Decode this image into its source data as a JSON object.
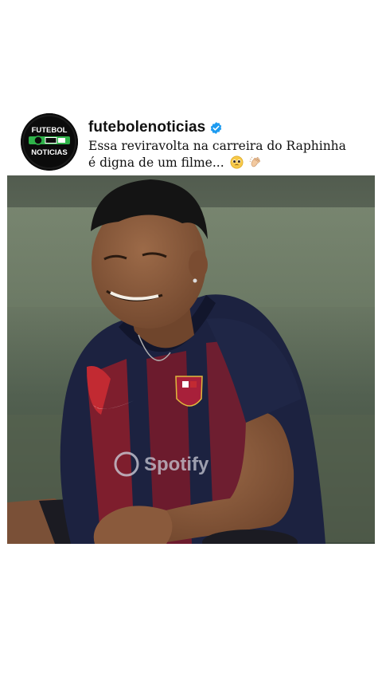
{
  "post": {
    "avatar": {
      "line1": "FUTEBOL",
      "line2": "NOTICIAS",
      "colors": {
        "background": "#0b0b0b",
        "ring": "#1b1b1b",
        "accent": "#2fb34a",
        "text": "#ffffff"
      }
    },
    "username": "futebolenoticias",
    "verified_icon": "verified-badge-icon",
    "verified_color": "#1d9bf0",
    "caption_line1": "Essa reviravolta na carreira do Raphinha",
    "caption_line2": "é digna de um filme...",
    "caption_emojis": [
      "pleading-face-icon",
      "clapping-hands-icon"
    ]
  },
  "media": {
    "description_icon": "video-frame-image",
    "jersey_sponsor": "Spotify",
    "colors": {
      "background": "#4f5a4c",
      "grass_light": "#7b8a72",
      "jersey_navy": "#1c2240",
      "jersey_red": "#8a1e2b",
      "skin": "#8a5a3c"
    }
  }
}
